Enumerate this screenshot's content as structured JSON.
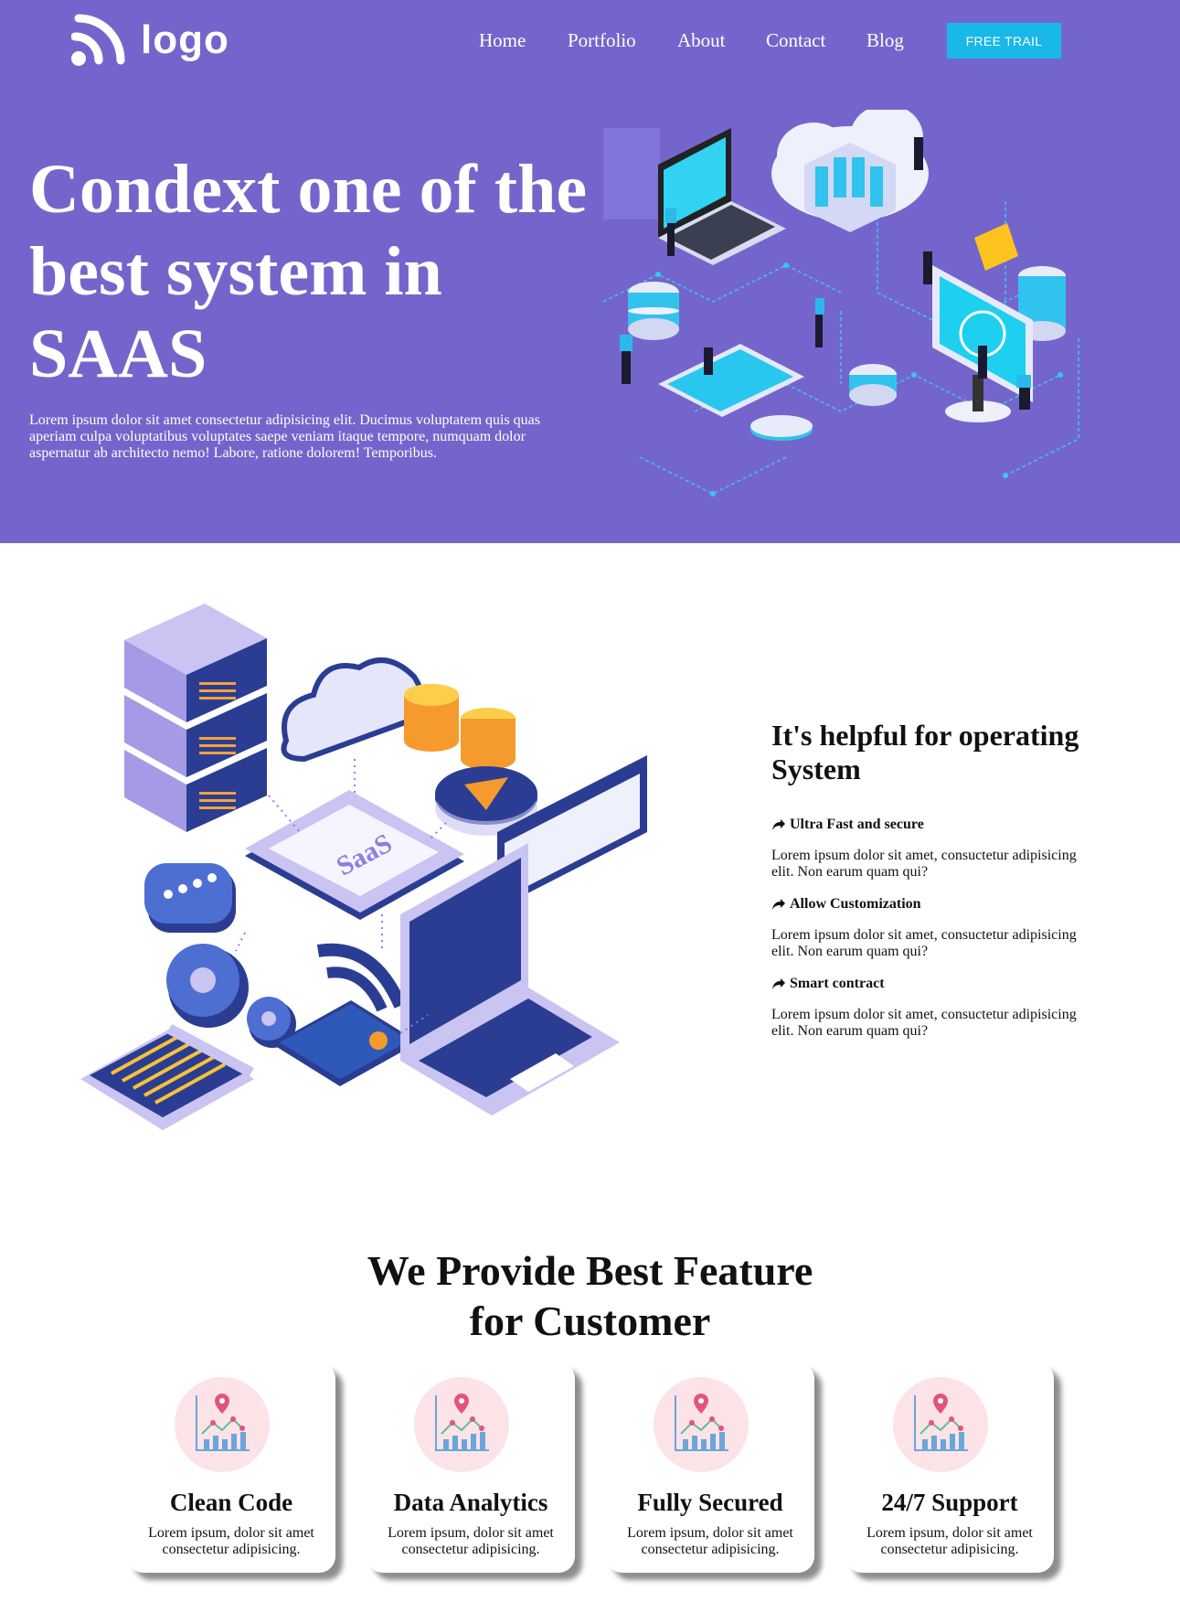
{
  "header": {
    "logo_text": "logo",
    "nav": [
      "Home",
      "Portfolio",
      "About",
      "Contact",
      "Blog"
    ],
    "cta_label": "FREE TRAIL"
  },
  "hero": {
    "title": "Condext one of the best system in SAAS",
    "text": "Lorem ipsum dolor sit amet consectetur adipisicing elit. Ducimus voluptatem quis quas aperiam culpa voluptatibus voluptates saepe veniam itaque tempore, numquam dolor aspernatur ab architecto nemo! Labore, ratione dolorem! Temporibus."
  },
  "operating": {
    "title": "It's helpful for operating System",
    "illustration_text": "SaaS",
    "features": [
      {
        "heading": "Ultra Fast and secure",
        "text": "Lorem ipsum dolor sit amet, consuctetur adipisicing elit. Non earum quam qui?"
      },
      {
        "heading": "Allow Customization",
        "text": "Lorem ipsum dolor sit amet, consuctetur adipisicing elit. Non earum quam qui?"
      },
      {
        "heading": "Smart contract",
        "text": "Lorem ipsum dolor sit amet, consuctetur adipisicing elit. Non earum quam qui?"
      }
    ]
  },
  "features_section": {
    "title_line1": "We Provide Best Feature",
    "title_line2": "for Customer",
    "cards": [
      {
        "title": "Clean Code",
        "text": "Lorem ipsum, dolor sit amet consectetur adipisicing."
      },
      {
        "title": "Data Analytics",
        "text": "Lorem ipsum, dolor sit amet consectetur adipisicing."
      },
      {
        "title": "Fully Secured",
        "text": "Lorem ipsum, dolor sit amet consectetur adipisicing."
      },
      {
        "title": "24/7 Support",
        "text": "Lorem ipsum, dolor sit amet consectetur adipisicing."
      }
    ]
  },
  "colors": {
    "hero_bg": "#7465cc",
    "cta_bg": "#19b8e8",
    "icon_circle": "#fbe3e8",
    "accent_cyan": "#1fc7f0",
    "accent_navy": "#1d3e8f"
  },
  "icons": [
    "logo-mark-icon",
    "share-arrow-icon",
    "analytics-chart-icon"
  ]
}
